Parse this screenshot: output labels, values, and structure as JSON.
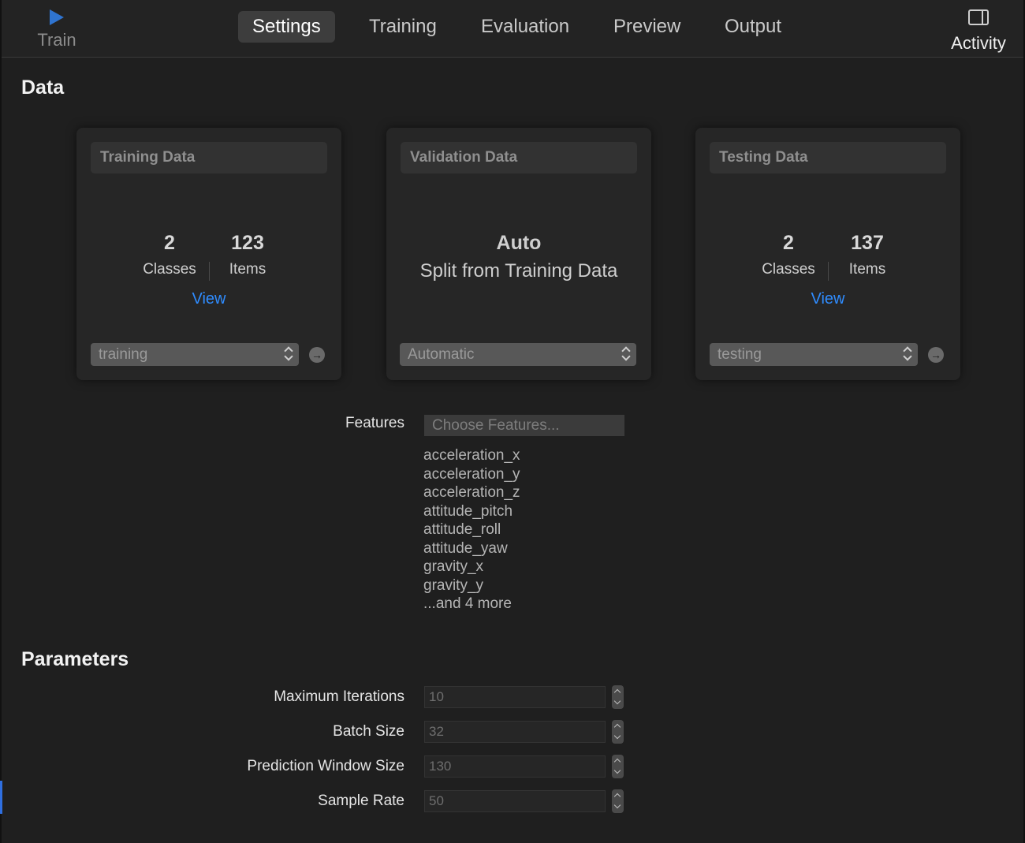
{
  "toolbar": {
    "train_label": "Train",
    "tabs": [
      {
        "label": "Settings",
        "active": true
      },
      {
        "label": "Training",
        "active": false
      },
      {
        "label": "Evaluation",
        "active": false
      },
      {
        "label": "Preview",
        "active": false
      },
      {
        "label": "Output",
        "active": false
      }
    ],
    "activity_label": "Activity"
  },
  "data_section": {
    "title": "Data",
    "training": {
      "header": "Training Data",
      "classes_count": "2",
      "classes_label": "Classes",
      "items_count": "123",
      "items_label": "Items",
      "view_link": "View",
      "source_value": "training"
    },
    "validation": {
      "header": "Validation Data",
      "title": "Auto",
      "subtitle": "Split from Training Data",
      "source_value": "Automatic"
    },
    "testing": {
      "header": "Testing Data",
      "classes_count": "2",
      "classes_label": "Classes",
      "items_count": "137",
      "items_label": "Items",
      "view_link": "View",
      "source_value": "testing"
    },
    "features": {
      "label": "Features",
      "placeholder": "Choose Features...",
      "items": [
        "acceleration_x",
        "acceleration_y",
        "acceleration_z",
        "attitude_pitch",
        "attitude_roll",
        "attitude_yaw",
        "gravity_x",
        "gravity_y",
        "...and 4 more"
      ]
    }
  },
  "parameters_section": {
    "title": "Parameters",
    "max_iterations": {
      "label": "Maximum Iterations",
      "value": "10"
    },
    "batch_size": {
      "label": "Batch Size",
      "value": "32"
    },
    "prediction_window_size": {
      "label": "Prediction Window Size",
      "value": "130"
    },
    "sample_rate": {
      "label": "Sample Rate",
      "value": "50"
    }
  },
  "colors": {
    "background": "#1f1f1f",
    "accent_link": "#2f8cff",
    "play_icon": "#2f74d0"
  }
}
